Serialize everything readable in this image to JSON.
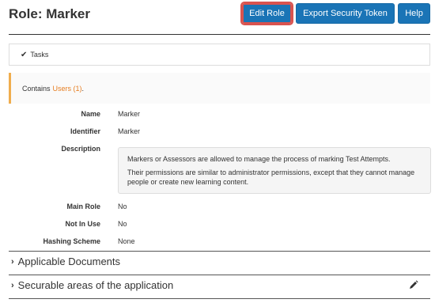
{
  "header": {
    "title": "Role: Marker",
    "edit_label": "Edit Role",
    "export_label": "Export Security Token",
    "help_label": "Help"
  },
  "tasks": {
    "label": "Tasks"
  },
  "contains": {
    "prefix": "Contains",
    "link": "Users (1)",
    "suffix": "."
  },
  "fields": {
    "name_label": "Name",
    "name_value": "Marker",
    "identifier_label": "Identifier",
    "identifier_value": "Marker",
    "description_label": "Description",
    "description_p1": "Markers or Assessors are allowed to manage the process of marking Test Attempts.",
    "description_p2": "Their permissions are similar to administrator permissions, except that they cannot manage people or create new learning content.",
    "main_role_label": "Main Role",
    "main_role_value": "No",
    "not_in_use_label": "Not In Use",
    "not_in_use_value": "No",
    "hashing_label": "Hashing Scheme",
    "hashing_value": "None"
  },
  "sections": {
    "applicable_docs": "Applicable Documents",
    "securable_areas": "Securable areas of the application"
  },
  "colors": {
    "primary": "#1a74b6",
    "highlight": "#d9534f",
    "warning": "#f0ad4e",
    "link": "#e67e22"
  }
}
